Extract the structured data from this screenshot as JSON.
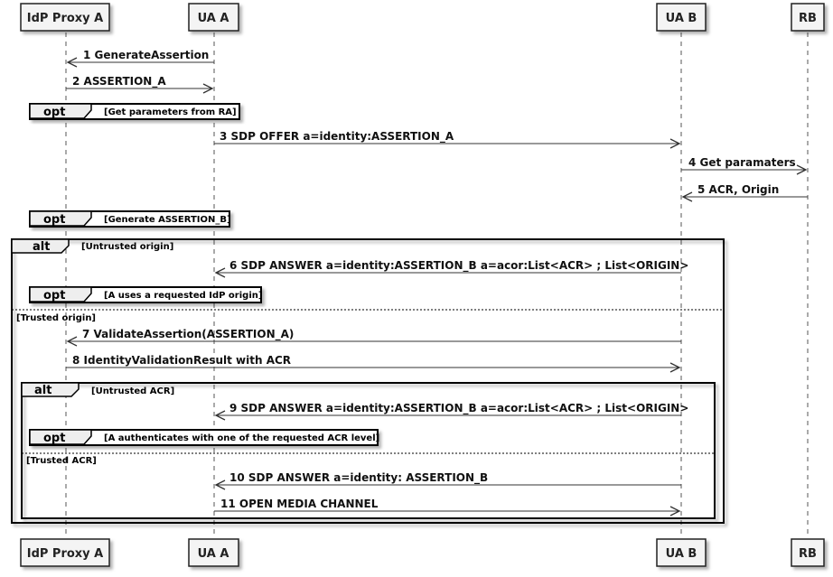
{
  "participants": [
    "IdP Proxy A",
    "UA A",
    "UA B",
    "RB"
  ],
  "messages": [
    {
      "from": 1,
      "to": 0,
      "label": "1 GenerateAssertion"
    },
    {
      "from": 0,
      "to": 1,
      "label": "2 ASSERTION_A"
    },
    {
      "from": 1,
      "to": 2,
      "label": "3 SDP OFFER a=identity:ASSERTION_A"
    },
    {
      "from": 2,
      "to": 3,
      "label": "4 Get paramaters"
    },
    {
      "from": 3,
      "to": 2,
      "label": "5 ACR, Origin"
    },
    {
      "from": 2,
      "to": 1,
      "label": "6 SDP ANSWER a=identity:ASSERTION_B a=acor:List<ACR> ; List<ORIGIN>"
    },
    {
      "from": 2,
      "to": 0,
      "label": "7 ValidateAssertion(ASSERTION_A)"
    },
    {
      "from": 0,
      "to": 2,
      "label": "8 IdentityValidationResult with ACR"
    },
    {
      "from": 2,
      "to": 1,
      "label": "9 SDP ANSWER a=identity:ASSERTION_B a=acor:List<ACR> ; List<ORIGIN>"
    },
    {
      "from": 2,
      "to": 1,
      "label": "10 SDP ANSWER a=identity: ASSERTION_B"
    },
    {
      "from": 1,
      "to": 2,
      "label": "11 OPEN MEDIA CHANNEL"
    }
  ],
  "fragments": {
    "opt_get_params": {
      "keyword": "opt",
      "condition": "[Get parameters from RA]"
    },
    "opt_generate_b": {
      "keyword": "opt",
      "condition": "[Generate ASSERTION_B]"
    },
    "alt_origin": {
      "keyword": "alt",
      "condition": "[Untrusted origin]",
      "else_condition": "[Trusted origin]"
    },
    "opt_requested_origin": {
      "keyword": "opt",
      "condition": "[A uses a requested IdP origin]"
    },
    "alt_acr": {
      "keyword": "alt",
      "condition": "[Untrusted ACR]",
      "else_condition": "[Trusted ACR]"
    },
    "opt_authenticate": {
      "keyword": "opt",
      "condition": "[A authenticates with one of the requested ACR level]"
    }
  }
}
